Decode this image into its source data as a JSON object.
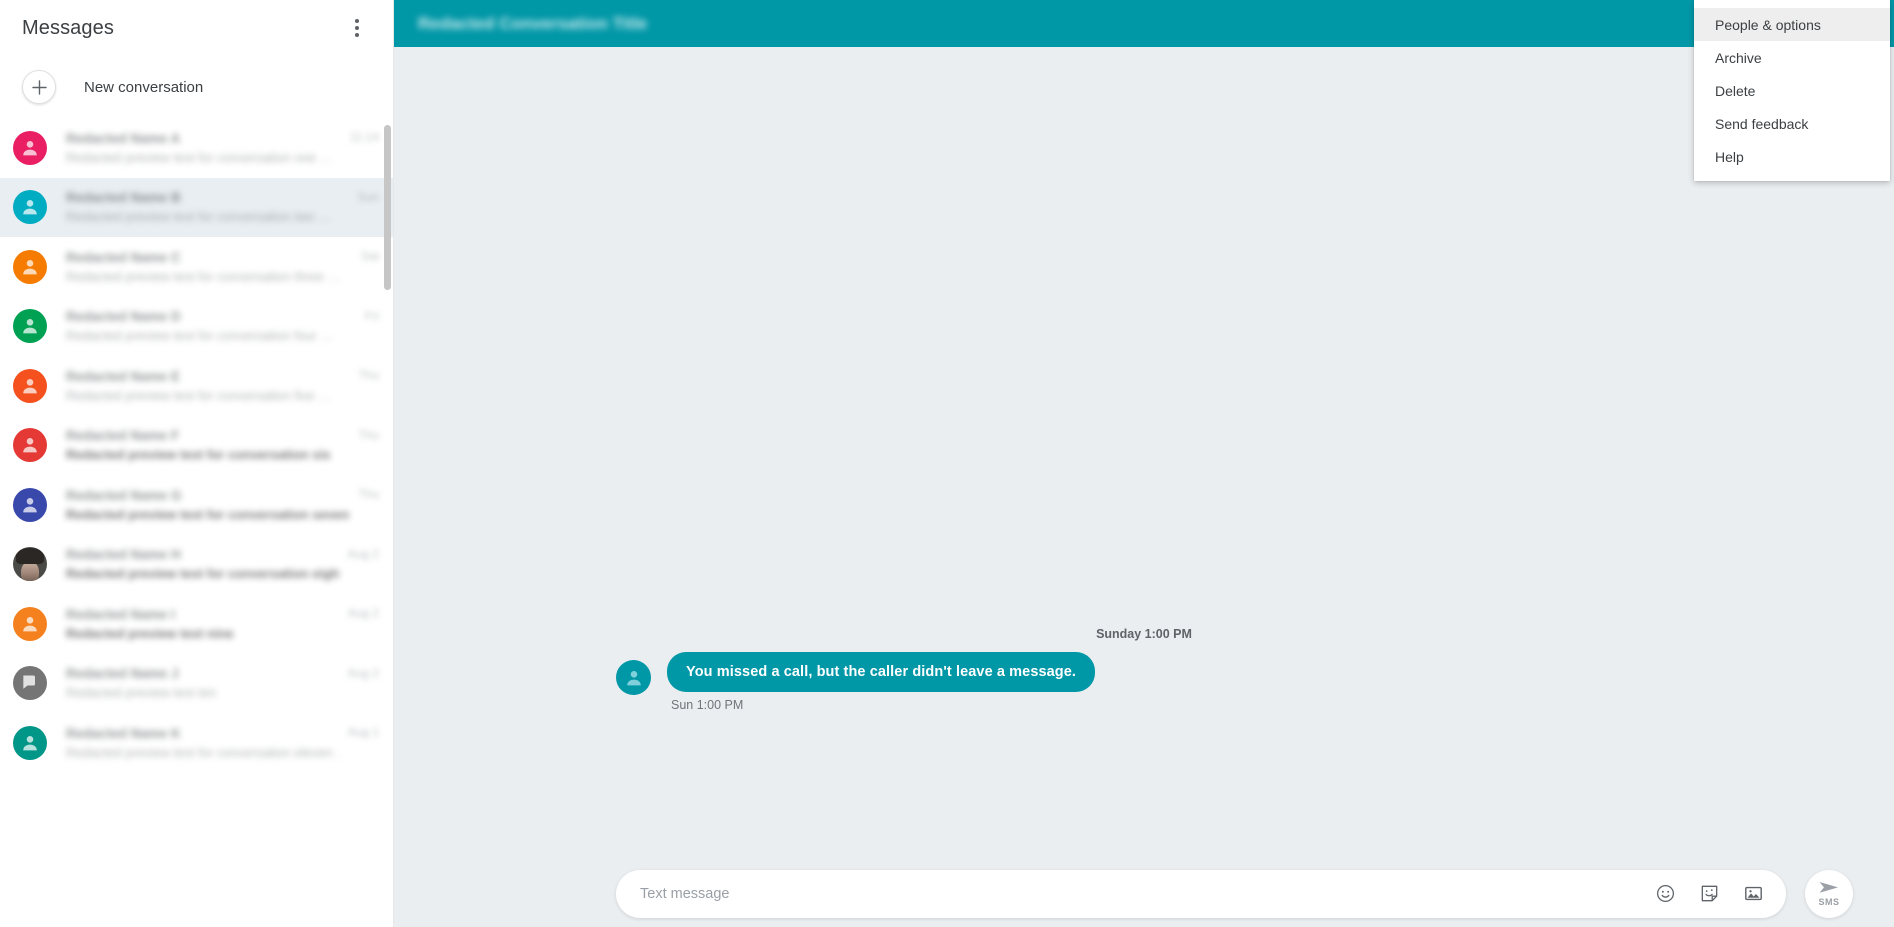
{
  "sidebar": {
    "title": "Messages",
    "overflow_icon": "kebab-menu-icon",
    "new_conversation": {
      "label": "New conversation",
      "icon": "plus-icon"
    },
    "conversations": [
      {
        "name": "Redacted Name A",
        "snippet": "Redacted preview text for conversation one …",
        "time": "11:14",
        "color": "#E91E63",
        "avatar": "person-icon",
        "unread": false
      },
      {
        "name": "Redacted Name B",
        "snippet": "Redacted preview text for conversation two …",
        "time": "Sun",
        "color": "#00ACC1",
        "avatar": "person-icon",
        "unread": false
      },
      {
        "name": "Redacted Name C",
        "snippet": "Redacted preview text for conversation three …",
        "time": "Sat",
        "color": "#F57C00",
        "avatar": "person-icon",
        "unread": false
      },
      {
        "name": "Redacted Name D",
        "snippet": "Redacted preview text for conversation four …",
        "time": "Fri",
        "color": "#00A152",
        "avatar": "person-icon",
        "unread": false
      },
      {
        "name": "Redacted Name E",
        "snippet": "Redacted preview text for conversation five …",
        "time": "Thu",
        "color": "#F4511E",
        "avatar": "person-icon",
        "unread": false
      },
      {
        "name": "Redacted Name F",
        "snippet": "Redacted preview text for conversation six",
        "time": "Thu",
        "color": "#E53935",
        "avatar": "person-icon",
        "unread": true
      },
      {
        "name": "Redacted Name G",
        "snippet": "Redacted preview text for conversation seven …",
        "time": "Thu",
        "color": "#3949AB",
        "avatar": "person-icon",
        "unread": true
      },
      {
        "name": "Redacted Name H",
        "snippet": "Redacted preview text for conversation eight …",
        "time": "Aug 2",
        "color": "#4A4A46",
        "avatar": "contact-photo",
        "unread": true
      },
      {
        "name": "Redacted Name I",
        "snippet": "Redacted preview text nine",
        "time": "Aug 2",
        "color": "#F4811E",
        "avatar": "person-icon",
        "unread": true
      },
      {
        "name": "Redacted Name J",
        "snippet": "Redacted preview text ten",
        "time": "Aug 2",
        "color": "#757575",
        "avatar": "group-icon",
        "unread": false
      },
      {
        "name": "Redacted Name K",
        "snippet": "Redacted preview text for conversation eleven …",
        "time": "Aug 1",
        "color": "#009688",
        "avatar": "person-icon",
        "unread": false
      }
    ]
  },
  "conversation": {
    "title": "Redacted Conversation Title",
    "date_divider": "Sunday 1:00 PM",
    "messages": [
      {
        "text": "You missed a call, but the caller didn't leave a message.",
        "time": "Sun 1:00 PM",
        "direction": "incoming",
        "avatar": "person-icon"
      }
    ]
  },
  "compose": {
    "placeholder": "Text message",
    "value": "",
    "icons": [
      "emoji-icon",
      "sticker-icon",
      "image-icon"
    ],
    "send": {
      "label": "SMS",
      "icon": "send-icon"
    }
  },
  "menu": {
    "items": [
      {
        "label": "People & options",
        "active": true
      },
      {
        "label": "Archive",
        "active": false
      },
      {
        "label": "Delete",
        "active": false
      },
      {
        "label": "Send feedback",
        "active": false
      },
      {
        "label": "Help",
        "active": false
      }
    ]
  },
  "colors": {
    "accent": "#0097A7",
    "chat_background": "#EAEEF0",
    "bubble_incoming": "#0097A7",
    "menu_hover": "#EEEEEE"
  }
}
